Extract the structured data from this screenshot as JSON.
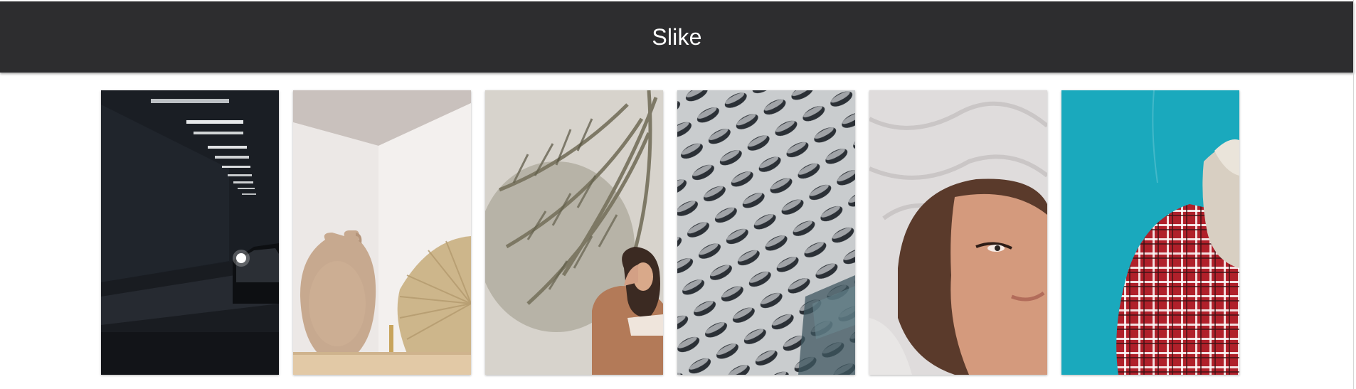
{
  "header": {
    "title": "Slike"
  },
  "gallery": {
    "photos": [
      {
        "subject": "tunnel-car"
      },
      {
        "subject": "vase-and-fan"
      },
      {
        "subject": "palm-and-woman"
      },
      {
        "subject": "building-facade"
      },
      {
        "subject": "woman-on-pillow"
      },
      {
        "subject": "person-plaid-shirt"
      }
    ]
  },
  "colors": {
    "header_bg": "#2d2d2f",
    "header_text": "#ffffff",
    "page_bg": "#ffffff",
    "accent_teal": "#1aa9bd"
  }
}
